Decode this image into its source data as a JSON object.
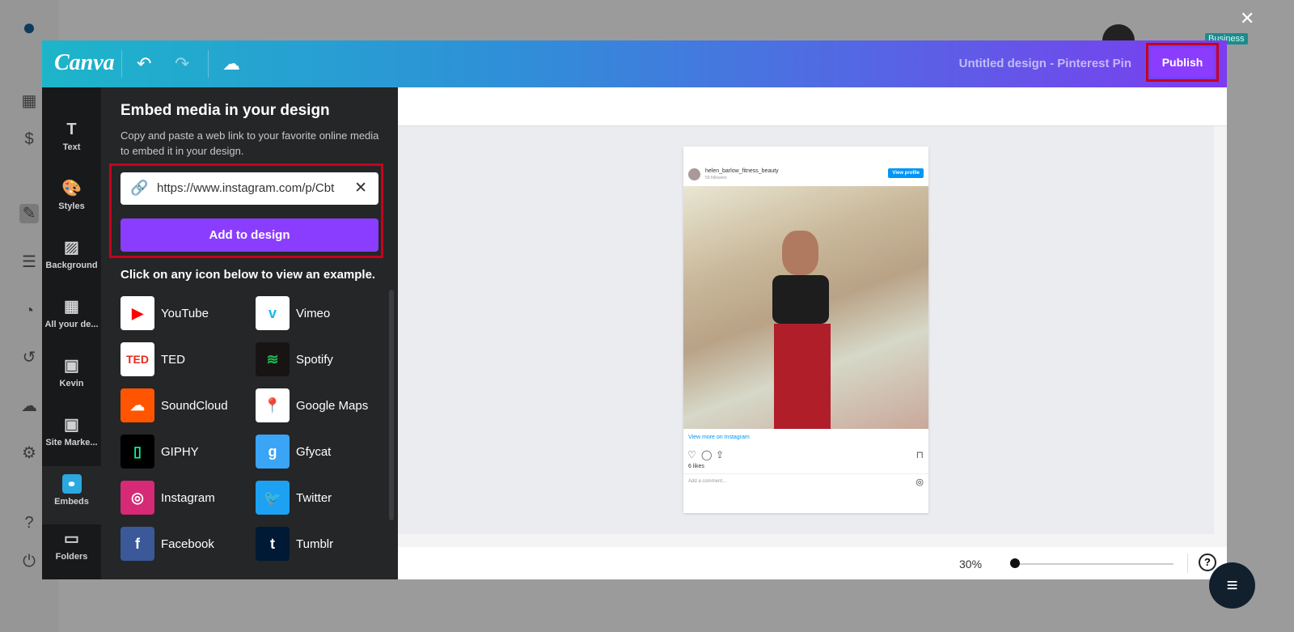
{
  "header": {
    "logo": "Canva",
    "title": "Untitled design - Pinterest Pin",
    "publish": "Publish",
    "badge": "Business"
  },
  "rail": [
    {
      "label": "Text",
      "icon": "T"
    },
    {
      "label": "Styles",
      "icon": "🎨"
    },
    {
      "label": "Background",
      "icon": "▨"
    },
    {
      "label": "All your de...",
      "icon": "▦"
    },
    {
      "label": "Kevin",
      "icon": "▣"
    },
    {
      "label": "Site Marke...",
      "icon": "▣"
    },
    {
      "label": "Embeds",
      "icon": "⚭"
    },
    {
      "label": "Folders",
      "icon": "▭"
    }
  ],
  "panel": {
    "title": "Embed media in your design",
    "desc": "Copy and paste a web link to your favorite online media to embed it in your design.",
    "url": "https://www.instagram.com/p/Cbt",
    "add": "Add to design",
    "hint": "Click on any icon below to view an example.",
    "items": [
      {
        "label": "YouTube",
        "icon": "▶",
        "bg": "#ffffff",
        "fg": "#ff0000"
      },
      {
        "label": "Vimeo",
        "icon": "v",
        "bg": "#ffffff",
        "fg": "#1ab7ea"
      },
      {
        "label": "TED",
        "icon": "TED",
        "bg": "#ffffff",
        "fg": "#e62b1e"
      },
      {
        "label": "Spotify",
        "icon": "≋",
        "bg": "#191414",
        "fg": "#1db954"
      },
      {
        "label": "SoundCloud",
        "icon": "☁",
        "bg": "#ff5500",
        "fg": "#ffffff"
      },
      {
        "label": "Google Maps",
        "icon": "📍",
        "bg": "#ffffff",
        "fg": "#ea4335"
      },
      {
        "label": "GIPHY",
        "icon": "▯",
        "bg": "#000000",
        "fg": "#00ff99"
      },
      {
        "label": "Gfycat",
        "icon": "g",
        "bg": "#3aa4f6",
        "fg": "#ffffff"
      },
      {
        "label": "Instagram",
        "icon": "◎",
        "bg": "#d62976",
        "fg": "#ffffff"
      },
      {
        "label": "Twitter",
        "icon": "🐦",
        "bg": "#1da1f2",
        "fg": "#ffffff"
      },
      {
        "label": "Facebook",
        "icon": "f",
        "bg": "#3b5998",
        "fg": "#ffffff"
      },
      {
        "label": "Tumblr",
        "icon": "t",
        "bg": "#001935",
        "fg": "#ffffff"
      }
    ]
  },
  "pin": {
    "user": "helen_barlow_fitness_beauty",
    "followers": "59 followers",
    "view_profile": "View profile",
    "view_more": "View more on Instagram",
    "likes": "6 likes",
    "comment_placeholder": "Add a comment..."
  },
  "zoom": {
    "value": "30%",
    "level": 30
  }
}
